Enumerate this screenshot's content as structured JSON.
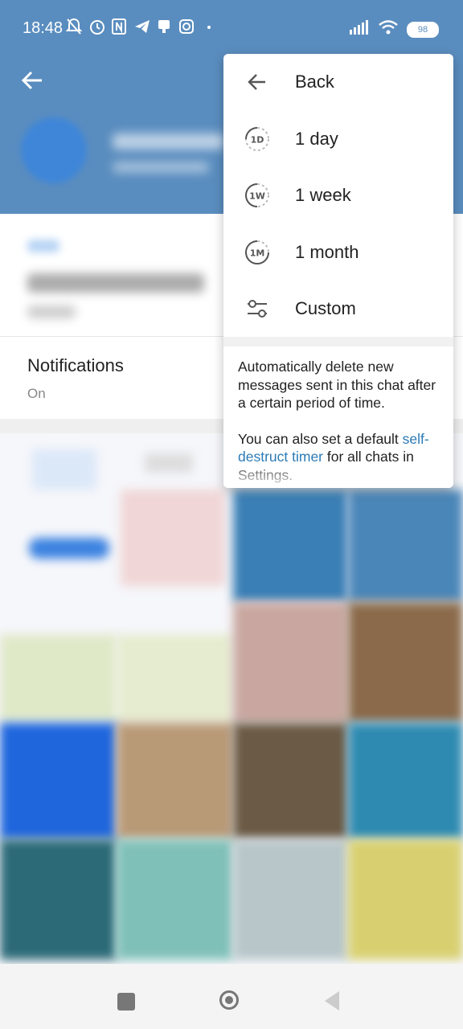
{
  "status_bar": {
    "time": "18:48",
    "battery": "98",
    "icons": [
      "bell-off-icon",
      "alarm-icon",
      "nfc-icon",
      "telegram-icon",
      "notification-icon",
      "instagram-icon",
      "dot-icon",
      "signal-icon",
      "wifi-icon",
      "battery-icon"
    ]
  },
  "header": {
    "background": "#5a8dbf"
  },
  "profile": {
    "notifications_label": "Notifications",
    "notifications_value": "On"
  },
  "popup": {
    "items": [
      {
        "label": "Back",
        "icon": "arrow-left-icon"
      },
      {
        "label": "1 day",
        "icon": "timer-1d-icon",
        "badge": "1D"
      },
      {
        "label": "1 week",
        "icon": "timer-1w-icon",
        "badge": "1W"
      },
      {
        "label": "1 month",
        "icon": "timer-1m-icon",
        "badge": "1M"
      },
      {
        "label": "Custom",
        "icon": "sliders-icon"
      }
    ],
    "description_1": "Automatically delete new messages sent in this chat after a certain period of time.",
    "description_2_before": "You can also set a default ",
    "description_2_link": "self-destruct timer",
    "description_2_after": " for all chats in Settings.",
    "link_color": "#2a7ab5"
  },
  "nav_bar": {
    "icons": [
      "recents-square-icon",
      "home-circle-icon",
      "back-triangle-icon"
    ]
  }
}
